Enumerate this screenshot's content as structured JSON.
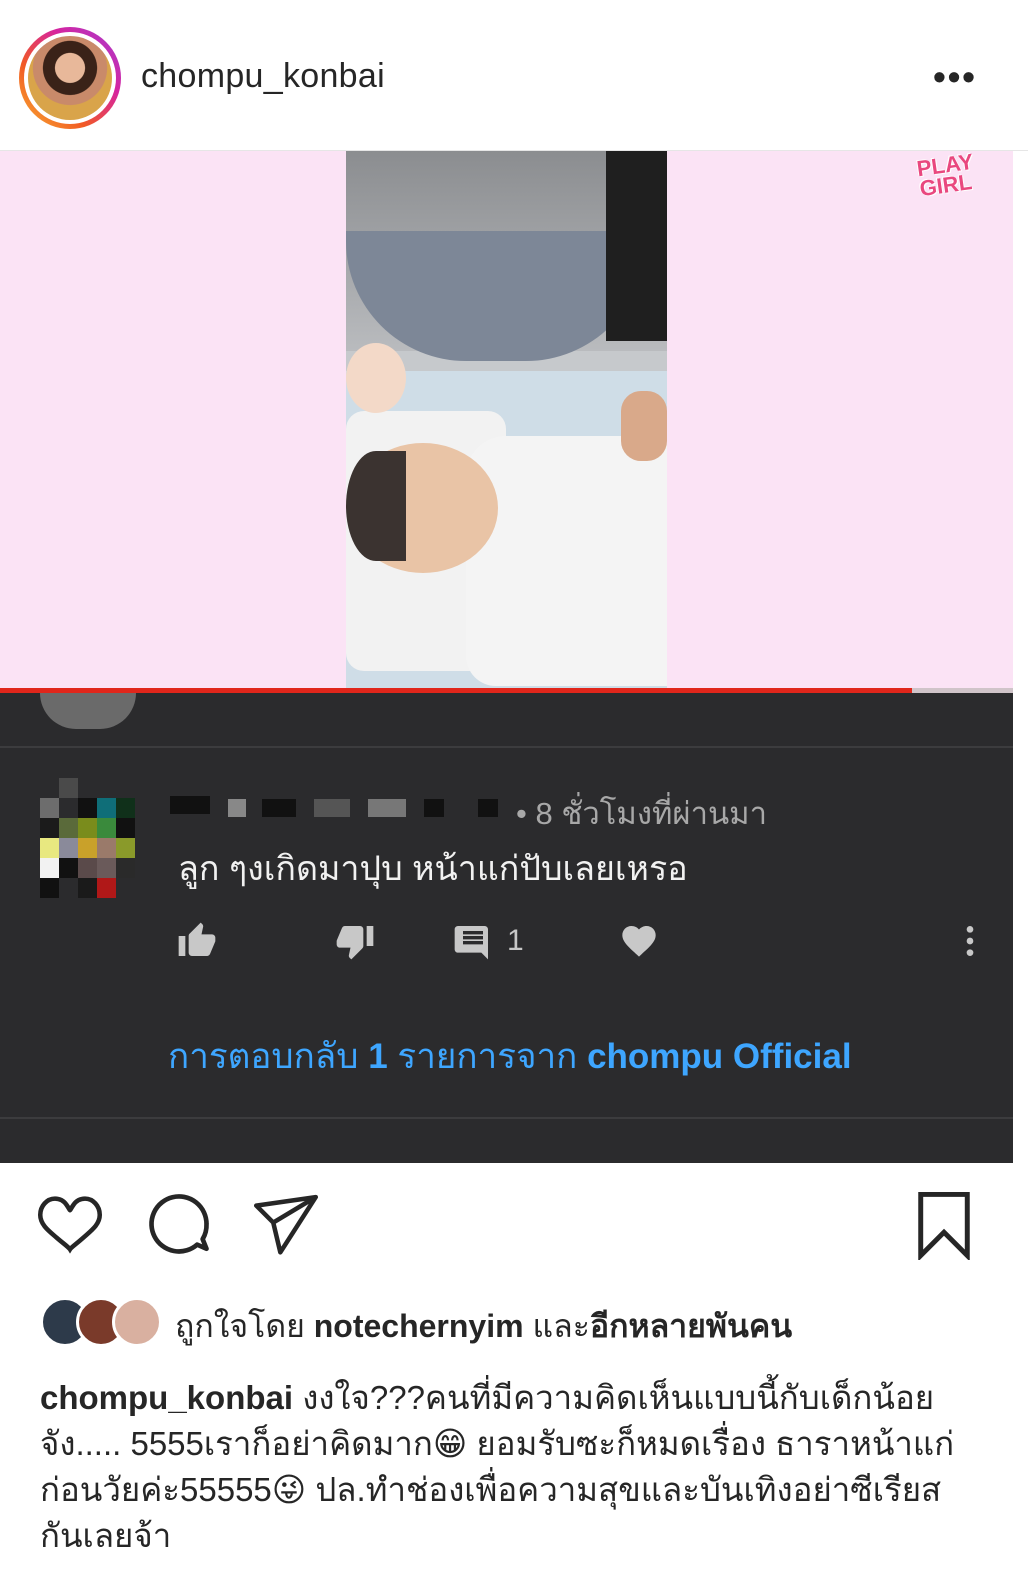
{
  "post": {
    "username": "chompu_konbai",
    "more_label": "•••"
  },
  "video": {
    "watermark": "PLAY GIRL",
    "progress": 0.9
  },
  "comment": {
    "time": "• 8 ชั่วโมงที่ผ่านมา",
    "text": "ลูก ๆงเกิดมาปุบ หน้าแก่ปับเลยเหรอ",
    "reply_count": "1",
    "replies_prefix": "การตอบกลับ ",
    "replies_num": "1",
    "replies_mid": " รายการจาก ",
    "replies_author": "chompu Official"
  },
  "likes": {
    "prefix": "ถูกใจโดย ",
    "user": "notechernyim",
    "middle": " และ",
    "others": "อีกหลายพันคน"
  },
  "caption": {
    "user": "chompu_konbai",
    "text": " งงใจ???คนที่มีความคิดเห็นแบบนี้กับเด็กน้อยจัง..... 5555เราก็อย่าคิดมาก😁 ยอมรับซะก็หมดเรื่อง ธาราหน้าแก่ก่อนวัยค่ะ55555😜 ปล.ทำช่องเพื่อความสุขและบันเทิงอย่าซีเรียสกันเลยจ้า"
  },
  "icons": {
    "like": "heart-icon",
    "comment": "comment-bubble-icon",
    "share": "paper-plane-icon",
    "save": "bookmark-icon",
    "thumb_up": "thumb-up-icon",
    "thumb_down": "thumb-down-icon",
    "replies": "comment-icon",
    "yt_heart": "heart-icon",
    "overflow": "vertical-dots-icon"
  },
  "colors": {
    "link_blue": "#3ea6ff",
    "progress_red": "#e0261b",
    "video_bg": "#fbe3f5",
    "dark_bg": "#2b2b2d"
  }
}
